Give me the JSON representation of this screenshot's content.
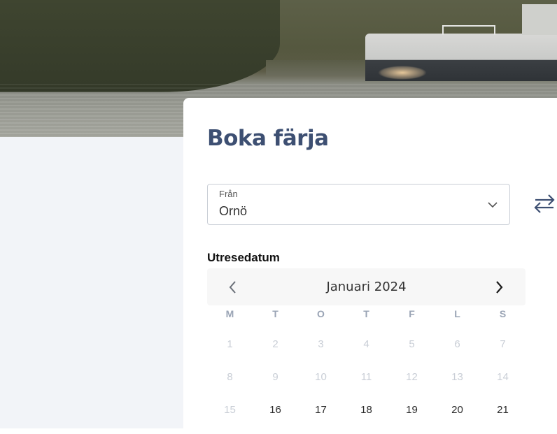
{
  "hero": {
    "image_name": "ferry-landscape-image"
  },
  "booking": {
    "title": "Boka färja",
    "from": {
      "label": "Från",
      "value": "Ornö"
    },
    "date_label": "Utresedatum"
  },
  "calendar": {
    "month": "Januari 2024",
    "weekdays": [
      "M",
      "T",
      "O",
      "T",
      "F",
      "L",
      "S"
    ],
    "weeks": [
      [
        {
          "d": "1",
          "disabled": true
        },
        {
          "d": "2",
          "disabled": true
        },
        {
          "d": "3",
          "disabled": true
        },
        {
          "d": "4",
          "disabled": true
        },
        {
          "d": "5",
          "disabled": true
        },
        {
          "d": "6",
          "disabled": true
        },
        {
          "d": "7",
          "disabled": true
        }
      ],
      [
        {
          "d": "8",
          "disabled": true
        },
        {
          "d": "9",
          "disabled": true
        },
        {
          "d": "10",
          "disabled": true
        },
        {
          "d": "11",
          "disabled": true
        },
        {
          "d": "12",
          "disabled": true
        },
        {
          "d": "13",
          "disabled": true
        },
        {
          "d": "14",
          "disabled": true
        }
      ],
      [
        {
          "d": "15",
          "disabled": true
        },
        {
          "d": "16",
          "disabled": false
        },
        {
          "d": "17",
          "disabled": false
        },
        {
          "d": "18",
          "disabled": false
        },
        {
          "d": "19",
          "disabled": false
        },
        {
          "d": "20",
          "disabled": false
        },
        {
          "d": "21",
          "disabled": false
        }
      ]
    ]
  },
  "colors": {
    "title": "#3d4f72",
    "disabled_day": "#c9ced6",
    "weekday": "#9aa4b5",
    "panel_bg": "#f2f4f8"
  }
}
